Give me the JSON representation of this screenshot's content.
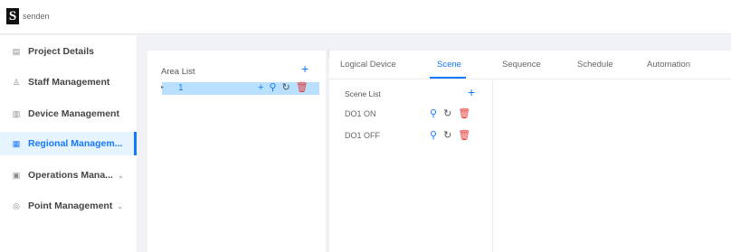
{
  "header": {
    "logo_letter": "S",
    "brand": "senden"
  },
  "sidebar": {
    "items": [
      {
        "label": "Project Details",
        "icon": "document-icon"
      },
      {
        "label": "Staff Management",
        "icon": "user-icon"
      },
      {
        "label": "Device Management",
        "icon": "device-icon"
      },
      {
        "label": "Regional Managem...",
        "icon": "grid-icon",
        "active": true
      },
      {
        "label": "Operations Mana...",
        "icon": "calendar-icon",
        "expandable": true
      },
      {
        "label": "Point Management",
        "icon": "location-icon",
        "expandable": true
      }
    ]
  },
  "area_panel": {
    "title": "Area List",
    "tree": [
      {
        "label": "1",
        "selected": true
      }
    ]
  },
  "tabs": [
    {
      "label": "Logical Device"
    },
    {
      "label": "Scene",
      "active": true
    },
    {
      "label": "Sequence"
    },
    {
      "label": "Schedule"
    },
    {
      "label": "Automation"
    }
  ],
  "scene_panel": {
    "title": "Scene List",
    "items": [
      {
        "name": "DO1 ON"
      },
      {
        "name": "DO1 OFF"
      }
    ]
  },
  "colors": {
    "accent": "#1677ff",
    "danger": "#e53935",
    "selected_bg": "#bae0ff",
    "active_nav_bg": "#e6f4ff"
  }
}
